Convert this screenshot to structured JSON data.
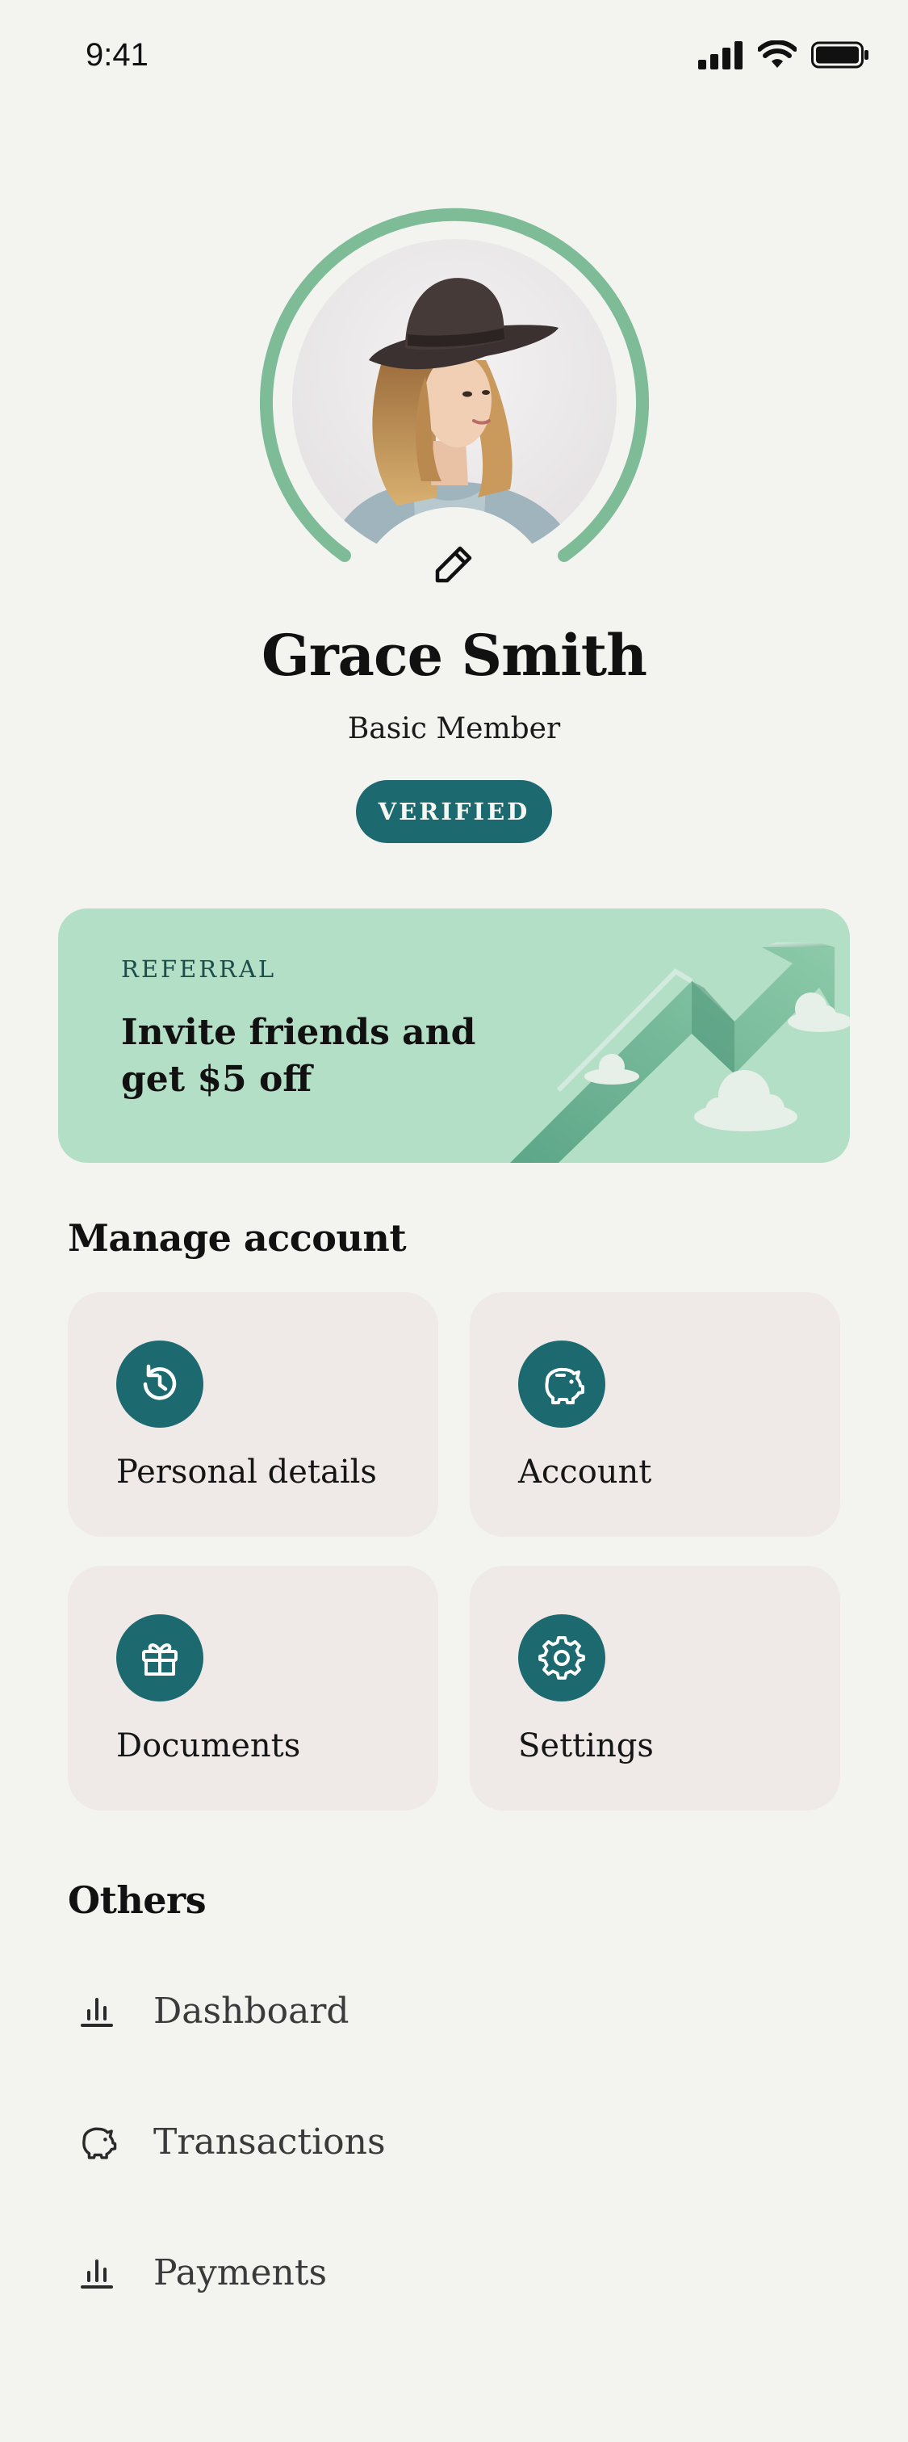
{
  "status_bar": {
    "time": "9:41",
    "icons": [
      "cellular-signal-icon",
      "wifi-icon",
      "battery-icon"
    ]
  },
  "profile": {
    "name": "Grace Smith",
    "tier": "Basic Member",
    "badge": "VERIFIED",
    "avatar": "profile-photo",
    "edit_icon": "pencil-icon"
  },
  "referral": {
    "eyebrow": "REFERRAL",
    "title": "Invite friends and get $5 off"
  },
  "manage": {
    "title": "Manage account",
    "tiles": [
      {
        "label": "Personal details",
        "icon": "history-icon"
      },
      {
        "label": "Account",
        "icon": "piggy-bank-icon"
      },
      {
        "label": "Documents",
        "icon": "gift-icon"
      },
      {
        "label": "Settings",
        "icon": "gear-icon"
      }
    ]
  },
  "others": {
    "title": "Others",
    "items": [
      {
        "label": "Dashboard",
        "icon": "bar-chart-icon"
      },
      {
        "label": "Transactions",
        "icon": "piggy-bank-icon"
      },
      {
        "label": "Payments",
        "icon": "bar-chart-icon"
      }
    ]
  },
  "colors": {
    "background": "#f3f3ef",
    "accent": "#1c6a70",
    "ring": "#7ebc98",
    "referral_bg": "#b4dfc7",
    "tile_bg": "#efeae7"
  }
}
